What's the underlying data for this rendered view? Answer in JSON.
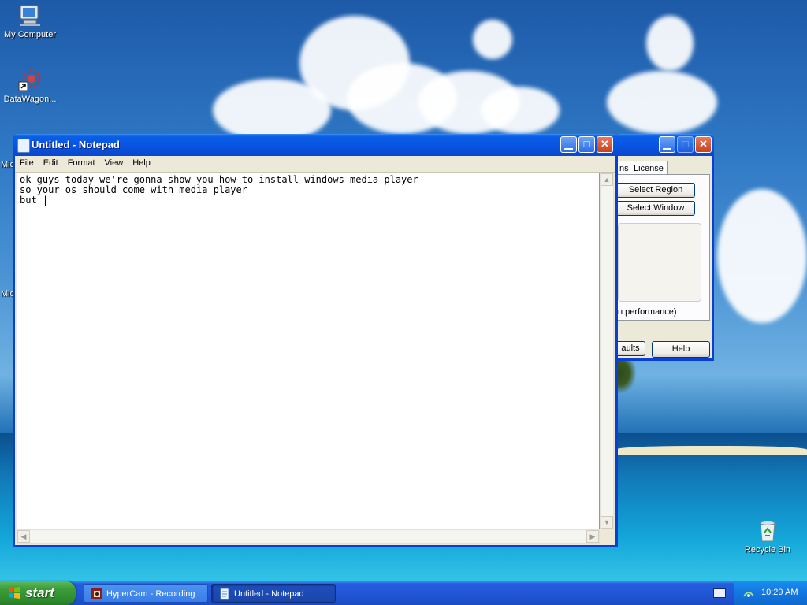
{
  "desktop": {
    "icons": [
      {
        "label": "My Computer",
        "icon": "my-computer-icon"
      },
      {
        "label": "DataWagon...",
        "icon": "datawagon-icon"
      },
      {
        "label": "Recycle Bin",
        "icon": "recycle-bin-icon"
      }
    ],
    "edge_labels": [
      "Mic",
      "Mic"
    ]
  },
  "notepad": {
    "title": "Untitled - Notepad",
    "menu": [
      "File",
      "Edit",
      "Format",
      "View",
      "Help"
    ],
    "lines": [
      "ok guys today we're gonna show you how to install windows media player",
      "so your os should come with media player",
      "but |"
    ]
  },
  "hypercam": {
    "tabs": [
      "ns",
      "License"
    ],
    "buttons": {
      "select_region": "Select Region",
      "select_window": "Select Window",
      "defaults": "aults",
      "help": "Help"
    },
    "performance_text": "n performance)"
  },
  "taskbar": {
    "start_label": "start",
    "tasks": [
      {
        "label": "HyperCam - Recording",
        "active": false
      },
      {
        "label": "Untitled - Notepad",
        "active": true
      }
    ],
    "clock": "10:29 AM"
  },
  "colors": {
    "titlebar_blue": "#0853e0",
    "taskbar_blue": "#245edb",
    "start_green": "#3c9e3a",
    "close_red": "#c8421c"
  }
}
